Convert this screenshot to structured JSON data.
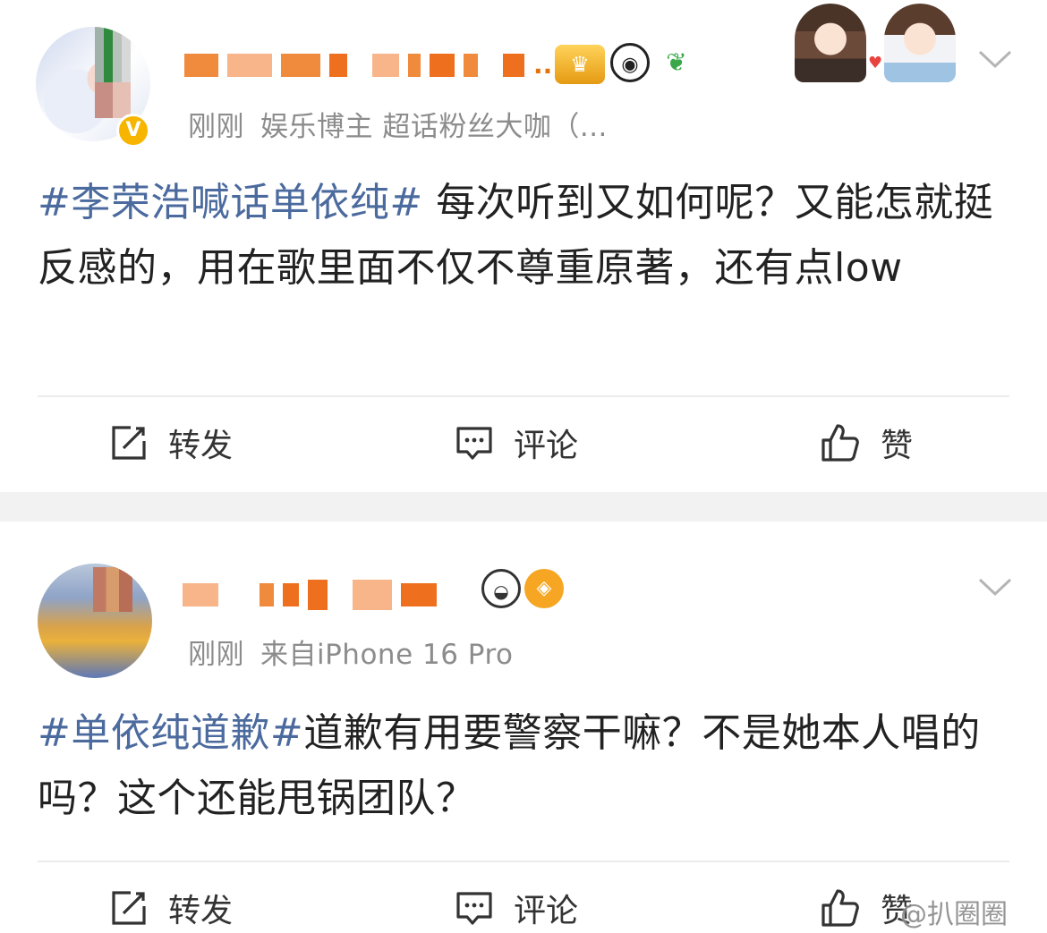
{
  "posts": [
    {
      "meta": {
        "time": "刚刚",
        "source": "娱乐博主 超话粉丝大咖（..."
      },
      "name_suffix": "..",
      "content": {
        "hashtag": "#李荣浩喊话单依纯#",
        "text": " 每次听到又如何呢？又能怎就挺反感的，用在歌里面不仅不尊重原著，还有点low"
      },
      "actions": {
        "repost": "转发",
        "comment": "评论",
        "like": "赞"
      }
    },
    {
      "meta": {
        "time": "刚刚",
        "source": "来自iPhone 16 Pro"
      },
      "content": {
        "hashtag": "#单依纯道歉#",
        "text": "道歉有用要警察干嘛？不是她本人唱的吗？这个还能甩锅团队？"
      },
      "actions": {
        "repost": "转发",
        "comment": "评论",
        "like": "赞"
      }
    }
  ],
  "watermark": "@扒圈圈",
  "icons": {
    "verified": "v-badge-icon",
    "crown": "crown-badge-icon",
    "panda": "panda-icon",
    "sprout": "sprout-icon",
    "cat": "cat-icon",
    "fish": "fish-icon",
    "more": "chevron-down-icon",
    "repost": "share-icon",
    "comment": "comment-icon",
    "like": "thumbs-up-icon"
  },
  "colors": {
    "hashtag": "#4b6a9e",
    "meta": "#8c8c8c",
    "text": "#222222",
    "verified": "#f7b500",
    "separator": "#f2f2f2"
  }
}
